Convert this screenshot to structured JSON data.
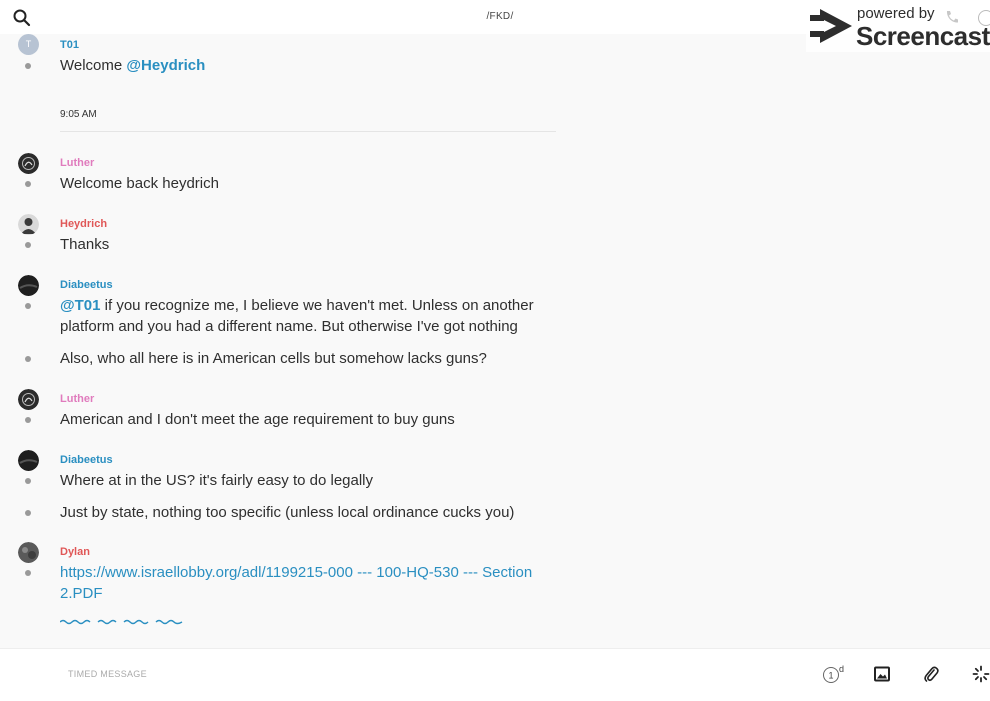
{
  "header": {
    "channel_title": "/FKD/",
    "search_icon": "search-icon"
  },
  "watermark": {
    "small_text": "powered by",
    "brand_text": "Screencastify"
  },
  "messages": [
    {
      "author": "T01",
      "avatar_letter": "T",
      "color": "#2a8fc1",
      "lines": [
        "Welcome @Heydrich"
      ],
      "mention": "@Heydrich",
      "rest": ""
    },
    {
      "time": "9:05 AM"
    },
    {
      "author": "Luther",
      "color": "#e07bbd",
      "lines": [
        "Welcome back heydrich"
      ]
    },
    {
      "author": "Heydrich",
      "color": "#e05757",
      "lines": [
        "Thanks"
      ]
    },
    {
      "author": "Diabeetus",
      "color": "#2a8fc1",
      "mention": "@T01",
      "lines": [
        " if you recognize me, I believe we haven't met. Unless on another",
        "platform and you had a different name. But otherwise I've got nothing",
        "Also, who all here is in American cells but somehow lacks guns?"
      ]
    },
    {
      "author": "Luther",
      "color": "#e07bbd",
      "lines": [
        "American and I don't meet the age requirement to buy guns"
      ]
    },
    {
      "author": "Diabeetus",
      "color": "#2a8fc1",
      "lines": [
        "Where at in the US? it's fairly easy to do legally",
        "Just by state, nothing too specific (unless local ordinance cucks you)"
      ]
    },
    {
      "author": "Dylan",
      "color": "#e05757",
      "lines": [
        "https://www.israellobby.org/adl/1199215-000 --- 100-HQ-530 --- Section",
        "2.PDF"
      ]
    }
  ],
  "composer": {
    "placeholder": "TIMED MESSAGE",
    "timer_value": "1",
    "timer_unit": "d"
  },
  "colors": {
    "accent": "#2a8fc1",
    "pink_user": "#e07bbd",
    "red_user": "#e05757",
    "background": "#f9f9f9"
  }
}
